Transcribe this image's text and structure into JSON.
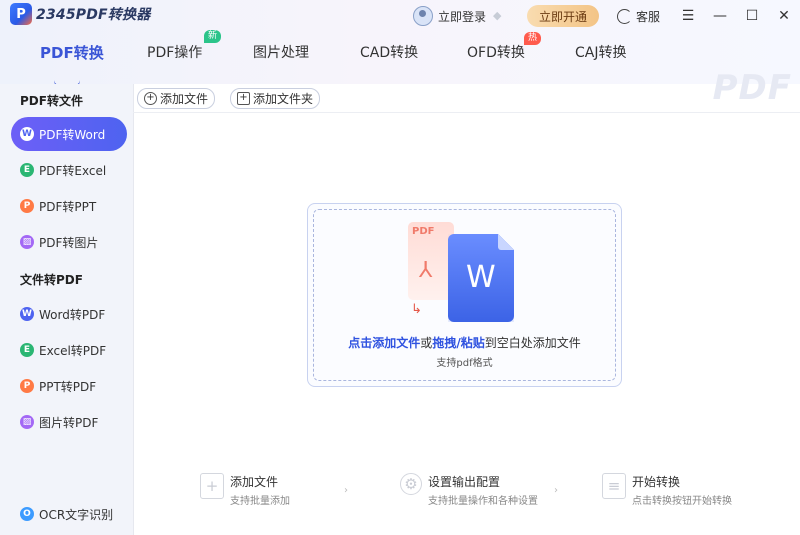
{
  "app": {
    "logo_letter": "P",
    "title": "2345PDF转换器"
  },
  "topbar": {
    "login_label": "立即登录",
    "vip_button": "立即开通",
    "service_label": "客服",
    "menu_glyph": "☰",
    "minimize_glyph": "—",
    "maximize_glyph": "☐",
    "close_glyph": "✕",
    "vip_color": "#f3c486"
  },
  "nav": {
    "tabs": [
      {
        "label": "PDF转换"
      },
      {
        "label": "PDF操作",
        "badge": "新"
      },
      {
        "label": "图片处理"
      },
      {
        "label": "CAD转换"
      },
      {
        "label": "OFD转换",
        "badge": "热"
      },
      {
        "label": "CAJ转换"
      }
    ],
    "watermark": "PDF"
  },
  "sidebar": {
    "group1": "PDF转文件",
    "group2": "文件转PDF",
    "items": [
      {
        "label": "PDF转Word",
        "icon": "W",
        "color": "#4e63f0"
      },
      {
        "label": "PDF转Excel",
        "icon": "E",
        "color": "#2bb673"
      },
      {
        "label": "PDF转PPT",
        "icon": "P",
        "color": "#ff7a45"
      },
      {
        "label": "PDF转图片",
        "icon": "▨",
        "color": "#a368f5"
      },
      {
        "label": "Word转PDF",
        "icon": "W",
        "color": "#4e63f0"
      },
      {
        "label": "Excel转PDF",
        "icon": "E",
        "color": "#2bb673"
      },
      {
        "label": "PPT转PDF",
        "icon": "P",
        "color": "#ff7a45"
      },
      {
        "label": "图片转PDF",
        "icon": "▨",
        "color": "#a368f5"
      },
      {
        "label": "OCR文字识别",
        "icon": "O",
        "color": "#3c9bff"
      }
    ],
    "accent": "#4e63f0"
  },
  "toolbar": {
    "add_file": "添加文件",
    "add_folder": "添加文件夹"
  },
  "dropzone": {
    "text_1": "点击添加文件",
    "text_2": "或",
    "text_3": "拖拽/粘贴",
    "text_4": "到空白处添加文件",
    "sub": "支持pdf格式",
    "pdf_label": "PDF",
    "pdf_glyph": "⅄",
    "arrow_glyph": "↳",
    "word_letter": "W"
  },
  "steps": [
    {
      "title": "添加文件",
      "sub": "支持批量添加",
      "icon": "+"
    },
    {
      "title": "设置输出配置",
      "sub": "支持批量操作和各种设置",
      "icon": "⚙"
    },
    {
      "title": "开始转换",
      "sub": "点击转换按钮开始转换",
      "icon": "≡"
    }
  ],
  "step_separator": "›"
}
